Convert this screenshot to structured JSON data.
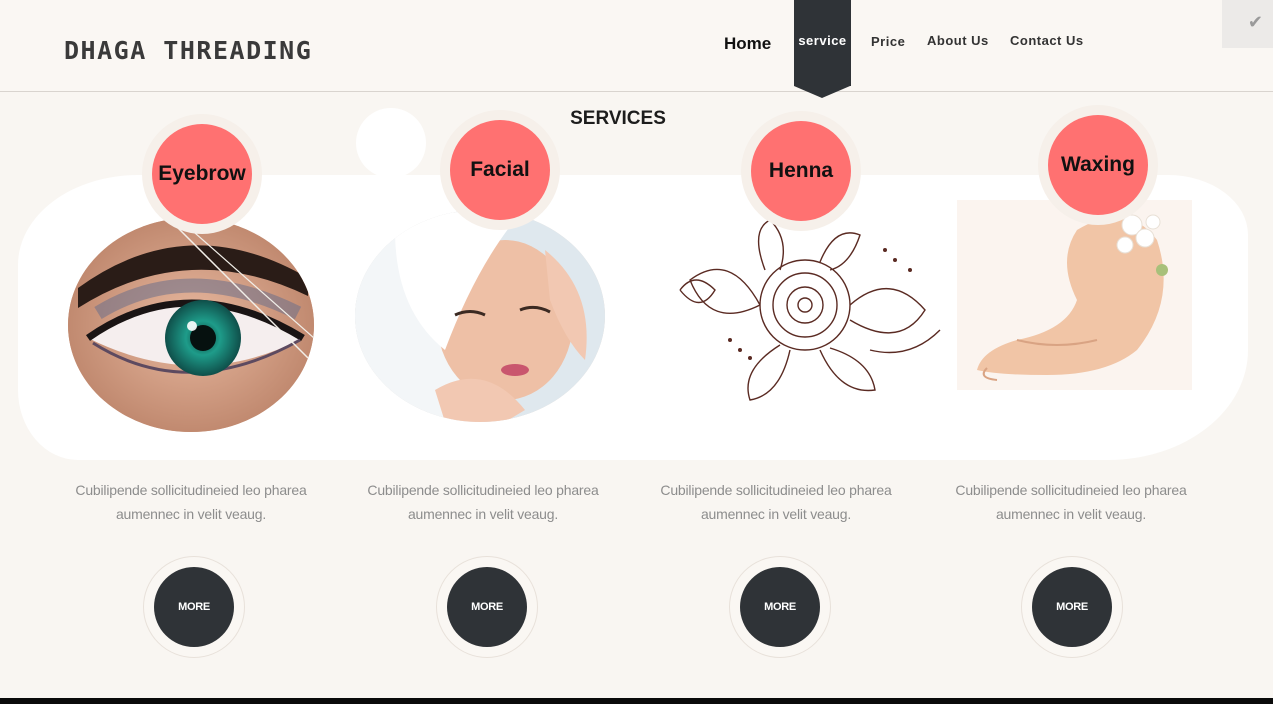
{
  "brand": {
    "logo": "DHAGA THREADING"
  },
  "nav": {
    "home": "Home",
    "service": "service",
    "price": "Price",
    "about": "About Us",
    "contact": "Contact Us"
  },
  "section_title": "SERVICES",
  "services": [
    {
      "name": "Eyebrow",
      "image": "eye-threading-photo",
      "desc_line1": "Cubilipende sollicitudineied leo pharea",
      "desc_line2": "aumennec in velit veaug.",
      "button": "MORE"
    },
    {
      "name": "Facial",
      "image": "facial-massage-photo",
      "desc_line1": "Cubilipende sollicitudineied leo pharea",
      "desc_line2": "aumennec in velit veaug.",
      "button": "MORE"
    },
    {
      "name": "Henna",
      "image": "henna-pattern-illustration",
      "desc_line1": "Cubilipende sollicitudineied leo pharea",
      "desc_line2": "aumennec in velit veaug.",
      "button": "MORE"
    },
    {
      "name": "Waxing",
      "image": "waxing-legs-photo",
      "desc_line1": "Cubilipende sollicitudineied leo pharea",
      "desc_line2": "aumennec in velit veaug.",
      "button": "MORE"
    }
  ],
  "colors": {
    "accent": "#ff7171",
    "dark": "#2f3337",
    "background": "#f9f6f2"
  }
}
